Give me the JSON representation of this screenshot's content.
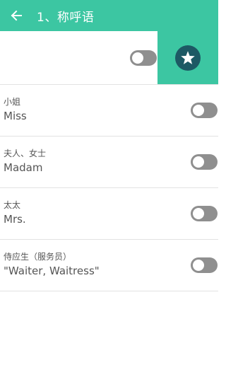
{
  "appbar": {
    "title": "1、称呼语",
    "back_icon": "arrow-left-icon"
  },
  "colors": {
    "primary": "#3cc6a2",
    "star_circle": "#1d5964",
    "toggle_off": "#8f8f8f",
    "text": "#555555",
    "divider": "#e2e2e2"
  },
  "top_row": {
    "toggle_state": "off",
    "favorite_icon": "star-icon"
  },
  "items": [
    {
      "cn": "小姐",
      "en": "Miss",
      "toggle_state": "off"
    },
    {
      "cn": "夫人、女士",
      "en": "Madam",
      "toggle_state": "off"
    },
    {
      "cn": "太太",
      "en": "Mrs.",
      "toggle_state": "off"
    },
    {
      "cn": "侍应生（服务员）",
      "en": "\"Waiter, Waitress\"",
      "toggle_state": "off"
    }
  ]
}
